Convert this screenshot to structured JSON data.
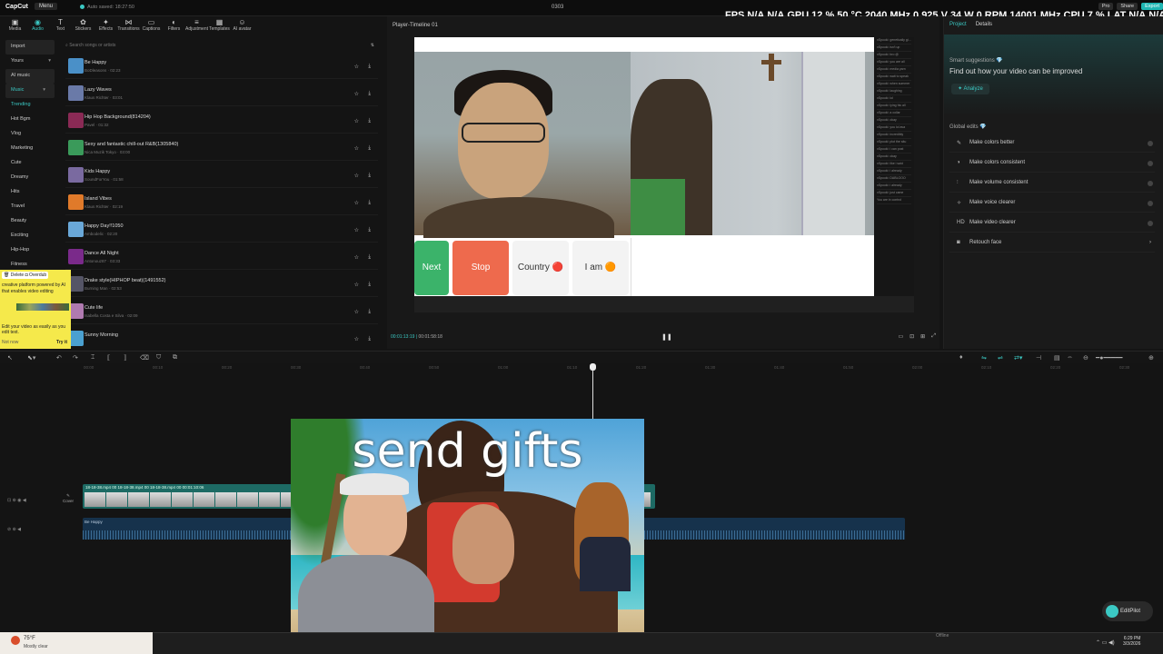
{
  "topbar": {
    "logo": "CapCut",
    "menu": "Menu",
    "autosave": "Auto saved: 18:27:50",
    "project_name": "0303",
    "hud": [
      "FPS",
      "N/A",
      "N/A",
      "GPU",
      "12 %",
      "50 °C",
      "2040 MHz",
      "0.925 V",
      "34 W",
      "0 RPM",
      "14001 MHz",
      "CPU",
      "7 %",
      "LAT",
      "N/A",
      "N/A"
    ],
    "pro": "Pro",
    "share": "Share",
    "export": "Export"
  },
  "toolbar": [
    {
      "label": "Media",
      "icon": "media-icon",
      "glyph": "▣"
    },
    {
      "label": "Audio",
      "icon": "audio-icon",
      "glyph": "◉",
      "active": true
    },
    {
      "label": "Text",
      "icon": "text-icon",
      "glyph": "T"
    },
    {
      "label": "Stickers",
      "icon": "sticker-icon",
      "glyph": "✿"
    },
    {
      "label": "Effects",
      "icon": "effects-icon",
      "glyph": "✦"
    },
    {
      "label": "Transitions",
      "icon": "transitions-icon",
      "glyph": "⋈"
    },
    {
      "label": "Captions",
      "icon": "captions-icon",
      "glyph": "▭"
    },
    {
      "label": "Filters",
      "icon": "filters-icon",
      "glyph": "◐"
    },
    {
      "label": "Adjustment",
      "icon": "adjustment-icon",
      "glyph": "≡"
    },
    {
      "label": "Templates",
      "icon": "templates-icon",
      "glyph": "▦"
    },
    {
      "label": "AI avatar",
      "icon": "ai-avatar-icon",
      "glyph": "☺"
    }
  ],
  "sidebar": [
    {
      "label": "Import",
      "hl": true
    },
    {
      "label": "Yours",
      "arrow": "▾"
    },
    {
      "label": "AI music",
      "hl": true
    },
    {
      "label": "Music",
      "hl": true,
      "active": true,
      "arrow": "▾"
    },
    {
      "label": "Trending",
      "active": true
    },
    {
      "label": "Hot Bgm"
    },
    {
      "label": "Vlog"
    },
    {
      "label": "Marketing"
    },
    {
      "label": "Cute"
    },
    {
      "label": "Dreamy"
    },
    {
      "label": "Hits"
    },
    {
      "label": "Travel"
    },
    {
      "label": "Beauty"
    },
    {
      "label": "Exciting"
    },
    {
      "label": "Hip-Hop"
    },
    {
      "label": "Fitness"
    }
  ],
  "search": {
    "placeholder": "Search songs or artists",
    "filter": "⇅"
  },
  "tracks": [
    {
      "title": "Be Happy",
      "sub": "BoDleasons · 02:23",
      "color": "#4a90c8"
    },
    {
      "title": "Lazy Waves",
      "sub": "Klaus Richter · 03:01",
      "color": "#6a7aa8"
    },
    {
      "title": "Hip Hop Background(814204)",
      "sub": "Pavel · 01:32",
      "color": "#8a2a55"
    },
    {
      "title": "Sexy and fantastic chill-out R&B(1305840)",
      "sub": "Nica Muzik Tokyo · 03:00",
      "color": "#3a9a5a"
    },
    {
      "title": "Kids Happy",
      "sub": "SoundForYou · 01:58",
      "color": "#7a6aa0"
    },
    {
      "title": "Island Vibes",
      "sub": "Klaus Richter · 02:19",
      "color": "#e07a2a"
    },
    {
      "title": "Happy Day!!1050",
      "sub": "Ambodelic · 02:20",
      "color": "#6aa8d8"
    },
    {
      "title": "Dance All Night",
      "sub": "Antonouz87 · 03:33",
      "color": "#7a2a8a"
    },
    {
      "title": "Drake style(HIPHOP beat)(1491552)",
      "sub": "Burning Man · 02:53",
      "color": "#555566"
    },
    {
      "title": "Cute life",
      "sub": "Isabella Costa e Silva · 02:09",
      "color": "#b07ab0"
    },
    {
      "title": "Sunny Morning",
      "sub": "",
      "color": "#4aa0d0"
    }
  ],
  "tooltip": {
    "bar": "🗑 Delete   ◘ Overdub",
    "body": "creative platform powered by AI that enables video editing",
    "foot": "Edit your video as easily as you edit text.",
    "not_now": "Not now",
    "try": "Try it"
  },
  "player": {
    "title": "Player-Timeline 01",
    "buttons": [
      "Next",
      "Stop",
      "Country 🔴",
      "I am 🟠"
    ],
    "timecode_current": "00:01:13:19",
    "timecode_total": "00:01:58:18"
  },
  "chat_lines": [
    "xSpooki: genetically gi...",
    "xSpooki: isn't up",
    "xSpooki: bro @",
    "xSpooki: you are all",
    "xSpooki: media yarn",
    "xSpooki: wait to speak",
    "xSpooki: when summer",
    "xSpooki: laughing",
    "xSpooki: lol",
    "xSpooki: lying his all",
    "xSpooki: a collar",
    "xSpooki: okay",
    "xSpooki: you lol ava",
    "xSpooki: incredibly",
    "xSpooki: plot the situ",
    "xSpooki: i can post",
    "xSpooki: okay",
    "xSpooki: like i said",
    "xSpooki: i already",
    "xSpooki: DABLOOO",
    "xSpooki: i already",
    "xSpooki: just came",
    "You are in control"
  ],
  "right_panel": {
    "tabs": [
      "Project",
      "Details"
    ],
    "smart_title": "Smart suggestions 💎",
    "smart_question": "Find out how your video can be improved",
    "analyze": "Analyze",
    "global_title": "Global edits 💎",
    "edits": [
      {
        "label": "Make colors better",
        "icon": "color-wand-icon",
        "glyph": "✎"
      },
      {
        "label": "Make colors consistent",
        "icon": "color-consistent-icon",
        "glyph": "◑"
      },
      {
        "label": "Make volume consistent",
        "icon": "volume-icon",
        "glyph": "⫶"
      },
      {
        "label": "Make voice clearer",
        "icon": "voice-icon",
        "glyph": "✧"
      },
      {
        "label": "Make video clearer",
        "icon": "hd-icon",
        "glyph": "HD"
      },
      {
        "label": "Retouch face",
        "icon": "retouch-icon",
        "glyph": "◙",
        "arrow": "›"
      }
    ]
  },
  "timeline": {
    "ruler": [
      "00:00",
      "00:10",
      "00:20",
      "00:30",
      "00:40",
      "00:50",
      "01:00",
      "01:10",
      "01:20",
      "01:30",
      "01:40",
      "01:50",
      "02:00",
      "02:10",
      "02:20",
      "02:30"
    ],
    "video_label": "18-18-38.mp4  00  18-18-38.mp4  00  18-18-38.mp4  00  00:01:10:06",
    "audio_label": "Be Happy",
    "cover": "Cover"
  },
  "meme": {
    "title": "send gifts"
  },
  "editpilot": "EditPilot",
  "taskbar": {
    "temp": "75°F",
    "weather": "Mostly clear",
    "offline": "Offline",
    "time": "6:29 PM",
    "date": "3/3/2026"
  },
  "colors": {
    "accent": "#3bc9c4",
    "bg": "#141414"
  }
}
